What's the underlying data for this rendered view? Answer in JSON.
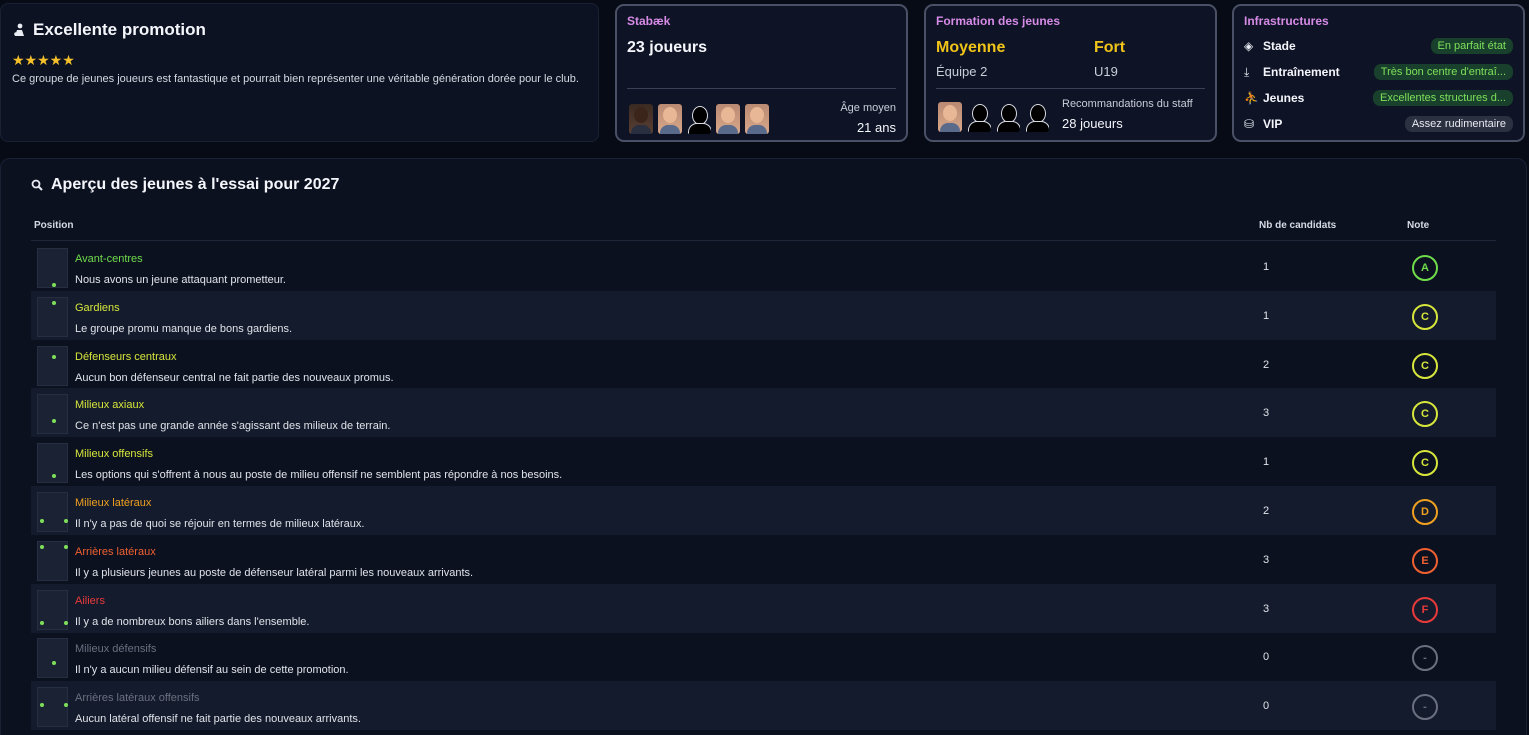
{
  "promotion": {
    "title": "Excellente promotion",
    "stars": "★★★★★",
    "description": "Ce groupe de jeunes joueurs est fantastique et pourrait bien représenter une véritable génération dorée pour le club."
  },
  "club": {
    "name": "Stabæk",
    "players": "23 joueurs",
    "avg_age_label": "Âge moyen",
    "avg_age_value": "21 ans"
  },
  "youth_training": {
    "title": "Formation des jeunes",
    "level1": "Moyenne",
    "team1": "Équipe 2",
    "level2": "Fort",
    "team2": "U19",
    "staff_label": "Recommandations du staff",
    "staff_value": "28 joueurs"
  },
  "infrastructure": {
    "title": "Infrastructures",
    "items": [
      {
        "icon": "stadium-icon",
        "label": "Stade",
        "value": "En parfait état",
        "color": "#7ee05a"
      },
      {
        "icon": "training-icon",
        "label": "Entraînement",
        "value": "Très bon centre d'entraî...",
        "color": "#7ee05a"
      },
      {
        "icon": "youth-icon",
        "label": "Jeunes",
        "value": "Excellentes structures d...",
        "color": "#7ee05a"
      },
      {
        "icon": "vip-icon",
        "label": "VIP",
        "value": "Assez rudimentaire",
        "color": "#e8ebf2"
      }
    ]
  },
  "overview": {
    "title": "Aperçu des jeunes à l'essai pour 2027",
    "col_position": "Position",
    "col_count": "Nb de candidats",
    "col_grade": "Note",
    "rows": [
      {
        "name": "Avant-centres",
        "desc": "Nous avons un jeune attaquant prometteur.",
        "count": "1",
        "grade": "A",
        "color": "#6fdc4a"
      },
      {
        "name": "Gardiens",
        "desc": "Le groupe promu manque de bons gardiens.",
        "count": "1",
        "grade": "C",
        "color": "#d6e63a"
      },
      {
        "name": "Défenseurs centraux",
        "desc": "Aucun bon défenseur central ne fait partie des nouveaux promus.",
        "count": "2",
        "grade": "C",
        "color": "#d6e63a"
      },
      {
        "name": "Milieux axiaux",
        "desc": "Ce n'est pas une grande année s'agissant des milieux de terrain.",
        "count": "3",
        "grade": "C",
        "color": "#d6e63a"
      },
      {
        "name": "Milieux offensifs",
        "desc": "Les options qui s'offrent à nous au poste de milieu offensif ne semblent pas répondre à nos besoins.",
        "count": "1",
        "grade": "C",
        "color": "#d6e63a"
      },
      {
        "name": "Milieux latéraux",
        "desc": "Il n'y a pas de quoi se réjouir en termes de milieux latéraux.",
        "count": "2",
        "grade": "D",
        "color": "#f0a020"
      },
      {
        "name": "Arrières latéraux",
        "desc": "Il y a plusieurs jeunes au poste de défenseur latéral parmi les nouveaux arrivants.",
        "count": "3",
        "grade": "E",
        "color": "#f06030"
      },
      {
        "name": "Ailiers",
        "desc": "Il y a de nombreux bons ailiers dans l'ensemble.",
        "count": "3",
        "grade": "F",
        "color": "#e83a3a"
      },
      {
        "name": "Milieux défensifs",
        "desc": "Il n'y a aucun milieu défensif au sein de cette promotion.",
        "count": "0",
        "grade": "-",
        "color": "#6b7080"
      },
      {
        "name": "Arrières latéraux offensifs",
        "desc": "Aucun latéral offensif ne fait partie des nouveaux arrivants.",
        "count": "0",
        "grade": "-",
        "color": "#6b7080"
      }
    ]
  }
}
